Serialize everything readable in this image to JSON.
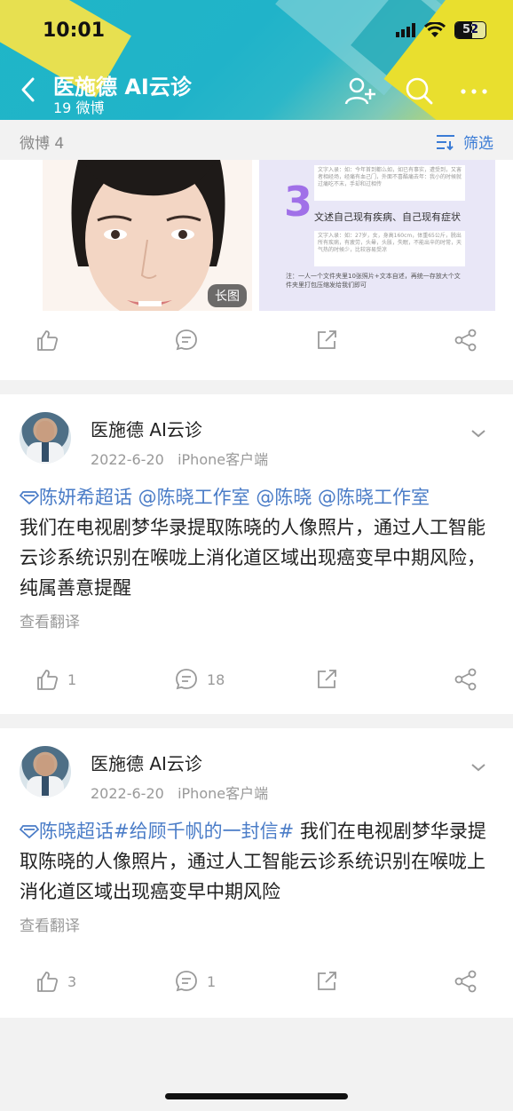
{
  "status": {
    "time": "10:01",
    "battery": "52"
  },
  "header": {
    "title": "医施德 AI云诊",
    "subtitle": "19 微博"
  },
  "filter": {
    "count_label": "微博 4",
    "filter_label": "筛选"
  },
  "image_post": {
    "badge": "长图",
    "doc_number": "3",
    "doc_heading": "文述自己现有疾病、自己现有症状",
    "doc_note": "注：一人一个文件夹里10张照片+文本自述，再统一存放大个文件夹里打包压缩发给我们即可",
    "doc_lines_top": "文字入录：如：今年首到都么如，如已有事实，遭受到，又害者相经场，经痛有血己门，外面不喜酷痛去年：我小的时候就过痛吃不末，手却和过相传",
    "doc_lines_mid": "文字入录：如：27岁，女，身高160cm，体重65公斤，脱出所有疾病，有疲劳，头晕，头胀，失眠，不能出辛的时常，天气热的时候少，比较容易受凉"
  },
  "posts": [
    {
      "username": "医施德 AI云诊",
      "date": "2022-6-20",
      "source": "iPhone客户端",
      "link_text": "陈妍希超话 @陈晓工作室 @陈晓 @陈晓工作室",
      "body": "我们在电视剧梦华录提取陈晓的人像照片，通过人工智能云诊系统识别在喉咙上消化道区域出现癌变早中期风险，纯属善意提醒",
      "translate": "查看翻译",
      "likes": "1",
      "comments": "18"
    },
    {
      "username": "医施德 AI云诊",
      "date": "2022-6-20",
      "source": "iPhone客户端",
      "link_text": "陈晓超话#给顾千帆的一封信#",
      "body": " 我们在电视剧梦华录提取陈晓的人像照片，通过人工智能云诊系统识别在喉咙上消化道区域出现癌变早中期风险",
      "translate": "查看翻译",
      "likes": "3",
      "comments": "1"
    }
  ]
}
